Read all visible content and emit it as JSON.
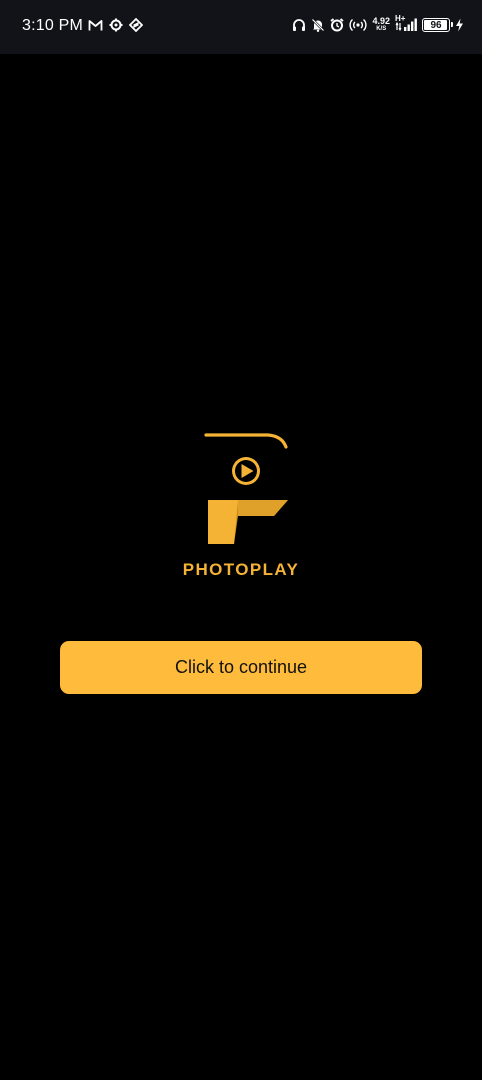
{
  "status_bar": {
    "time": "3:10 PM",
    "net_speed_value": "4.92",
    "net_speed_unit": "K/S",
    "network_type": "H+",
    "battery_level": "96",
    "battery_fraction": 0.96,
    "left_icons": [
      "gmail-icon",
      "settings-gear-icon",
      "app-notification-icon"
    ],
    "right_icons": [
      "headphones-icon",
      "mute-bell-icon",
      "alarm-icon",
      "hotspot-icon",
      "signal-icon",
      "battery-icon",
      "charging-icon"
    ]
  },
  "splash": {
    "brand_name": "PHOTOPLAY",
    "continue_label": "Click to continue"
  },
  "colors": {
    "background": "#000000",
    "status_bar_bg": "#111318",
    "accent": "#ffbb3c",
    "brand_gold": "#f5b335",
    "brand_gold_dark": "#c98a16"
  }
}
